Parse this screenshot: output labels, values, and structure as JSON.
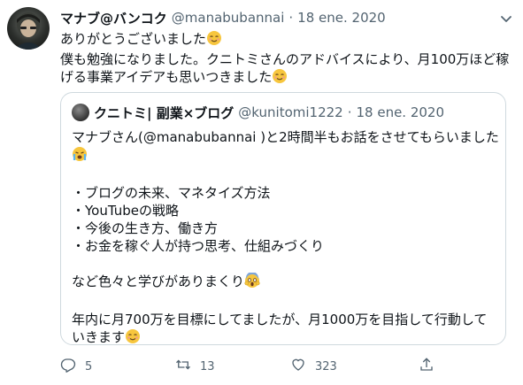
{
  "tweet": {
    "display_name": "マナブ@バンコク",
    "handle": "@manabubannai",
    "separator": "·",
    "date": "18 ene. 2020",
    "lines": [
      "ありがとうございました",
      "僕も勉強になりました。クニトミさんのアドバイスにより、月100万ほど稼",
      "げる事業アイデアも思いつきました"
    ]
  },
  "quote": {
    "display_name": "クニトミ| 副業×ブログ",
    "handle": "@kunitomi1222",
    "separator": "·",
    "date": "18 ene. 2020",
    "lines": [
      "マナブさん(@manabubannai )と2時間半もお話をさせてもらいました",
      "",
      "",
      "・ブログの未来、マネタイズ方法",
      "・YouTubeの戦略",
      "・今後の生き方、働き方",
      "・お金を稼ぐ人が持つ思考、仕組みづくり",
      "",
      "など色々と学びがありまくり",
      "",
      "年内に月700万を目標にしてましたが、月1000万を目指して行動して",
      "いきます"
    ]
  },
  "actions": {
    "replies": "5",
    "retweets": "13",
    "likes": "323"
  },
  "icons": {
    "reply": "reply-icon",
    "retweet": "retweet-icon",
    "like": "heart-icon",
    "share": "share-icon",
    "more": "chevron-down-icon"
  },
  "colors": {
    "text": "#0f1419",
    "secondary": "#536471",
    "border": "#cfd9de"
  }
}
